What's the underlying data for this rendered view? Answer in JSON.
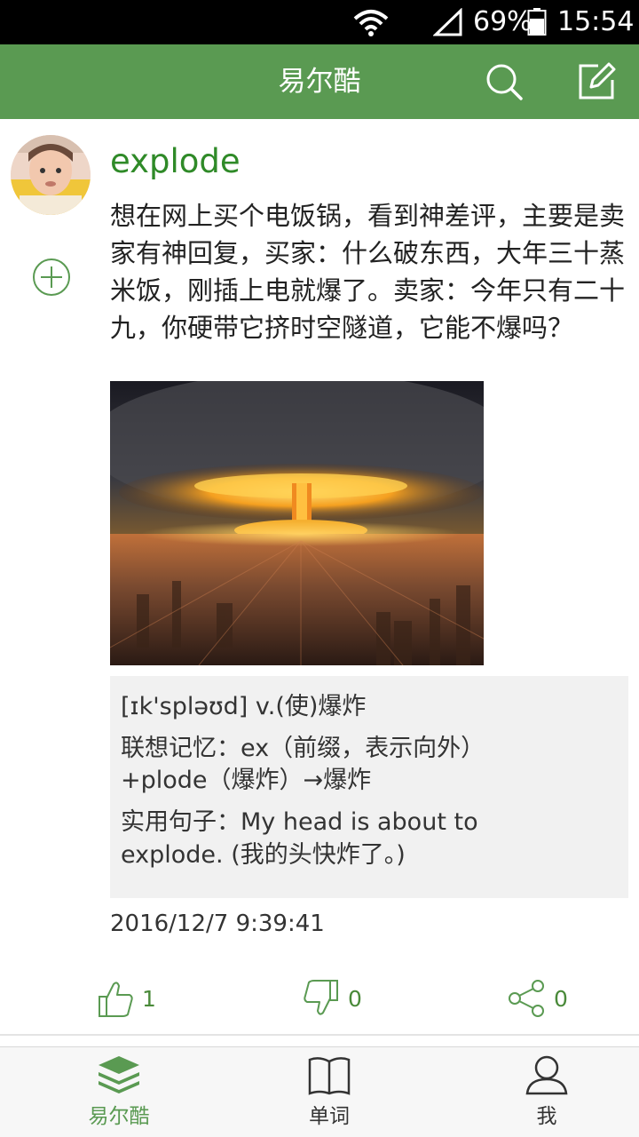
{
  "status_bar": {
    "battery_percent": "69%",
    "time": "15:54",
    "icons": [
      "wifi-icon",
      "signal-icon",
      "battery-icon"
    ]
  },
  "app_bar": {
    "title": "易尔酷",
    "icons": [
      "search-icon",
      "edit-icon"
    ],
    "color": "#5a9a52"
  },
  "post": {
    "username": "explode",
    "body": "想在网上买个电饭锅，看到神差评，主要是卖家有神回复，买家：什么破东西，大年三十蒸米饭，刚插上电就爆了。卖家：今年只有二十九，你硬带它挤时空隧道，它能不爆吗？",
    "word_card": {
      "pronunciation": "[ɪk'spləʊd]  v.(使)爆炸",
      "association": "联想记忆：ex（前缀，表示向外）+plode（爆炸）→爆炸",
      "example": "实用句子：My head is about to explode. (我的头快炸了。)"
    },
    "timestamp": "2016/12/7 9:39:41",
    "actions": {
      "likes": "1",
      "dislikes": "0",
      "shares": "0"
    }
  },
  "bottom_nav": {
    "items": [
      {
        "label": "易尔酷",
        "icon": "layers-icon",
        "active": true
      },
      {
        "label": "单词",
        "icon": "book-icon",
        "active": false
      },
      {
        "label": "我",
        "icon": "user-icon",
        "active": false
      }
    ]
  },
  "colors": {
    "accent": "#5a9a52",
    "username": "#2f8a28",
    "card_bg": "#f1f1f1"
  }
}
